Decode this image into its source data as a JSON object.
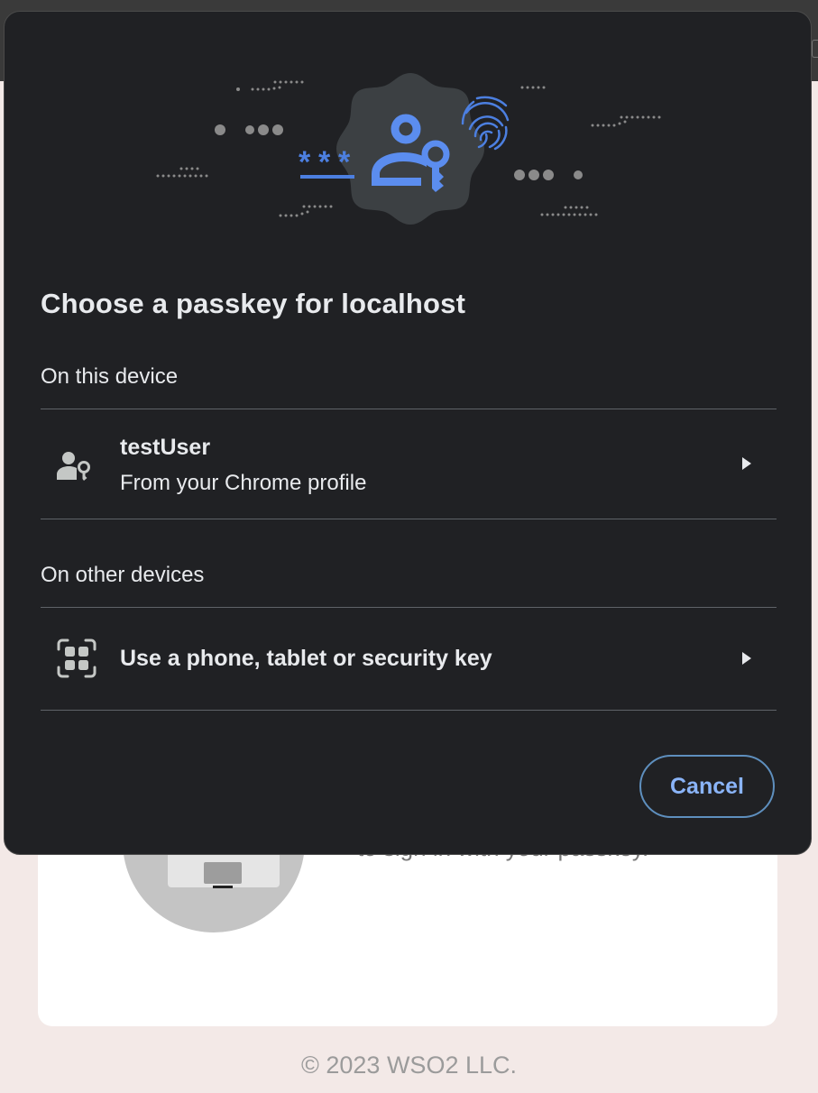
{
  "background": {
    "card_text": "to sign in with your passkey.",
    "footer": "© 2023 WSO2 LLC."
  },
  "dialog": {
    "title": "Choose a passkey for localhost",
    "sections": [
      {
        "label": "On this device",
        "items": [
          {
            "icon": "person-key-icon",
            "primary": "testUser",
            "secondary": "From your Chrome profile"
          }
        ]
      },
      {
        "label": "On other devices",
        "items": [
          {
            "icon": "qr-scan-icon",
            "primary": "Use a phone, tablet or security key"
          }
        ]
      }
    ],
    "cancel_label": "Cancel"
  },
  "colors": {
    "dialog_bg": "#202124",
    "accent_blue": "#4c7fe0",
    "link_blue": "#8ab4f8",
    "text": "#e8eaed"
  }
}
